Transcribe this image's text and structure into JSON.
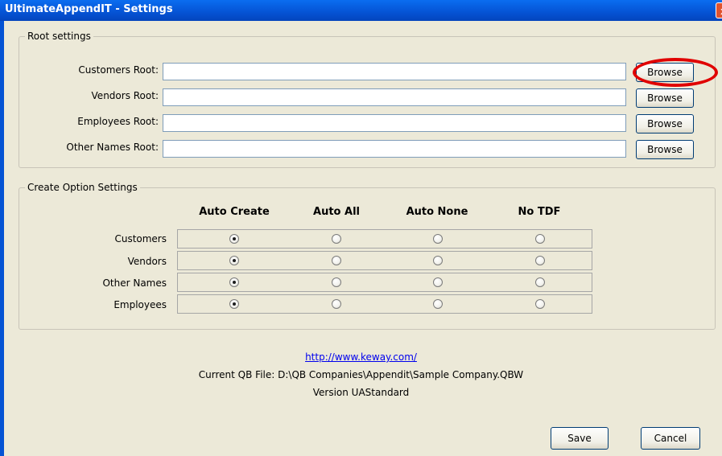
{
  "window": {
    "title": "UltimateAppendIT - Settings",
    "close_glyph": "x"
  },
  "root_settings": {
    "legend": "Root settings",
    "fields": [
      {
        "label": "Customers Root:",
        "value": "",
        "browse_label": "Browse"
      },
      {
        "label": "Vendors Root:",
        "value": "",
        "browse_label": "Browse"
      },
      {
        "label": "Employees Root:",
        "value": "",
        "browse_label": "Browse"
      },
      {
        "label": "Other Names Root:",
        "value": "",
        "browse_label": "Browse"
      }
    ],
    "highlighted_button": "Browse",
    "highlight_color": "#e00000"
  },
  "create_options": {
    "legend": "Create Option Settings",
    "columns": [
      "Auto Create",
      "Auto All",
      "Auto None",
      "No TDF"
    ],
    "rows": [
      {
        "label": "Customers",
        "selected": "Auto Create"
      },
      {
        "label": "Vendors",
        "selected": "Auto Create"
      },
      {
        "label": "Other Names",
        "selected": "Auto Create"
      },
      {
        "label": "Employees",
        "selected": "Auto Create"
      }
    ]
  },
  "footer": {
    "link": "http://www.keway.com/",
    "current_file": "Current QB File: D:\\QB Companies\\Appendit\\Sample Company.QBW",
    "version": "Version UAStandard"
  },
  "buttons": {
    "save": "Save",
    "cancel": "Cancel"
  },
  "colors": {
    "titlebar": "#0553d4",
    "dialog_bg": "#ece9d8",
    "link": "#0000ee"
  }
}
